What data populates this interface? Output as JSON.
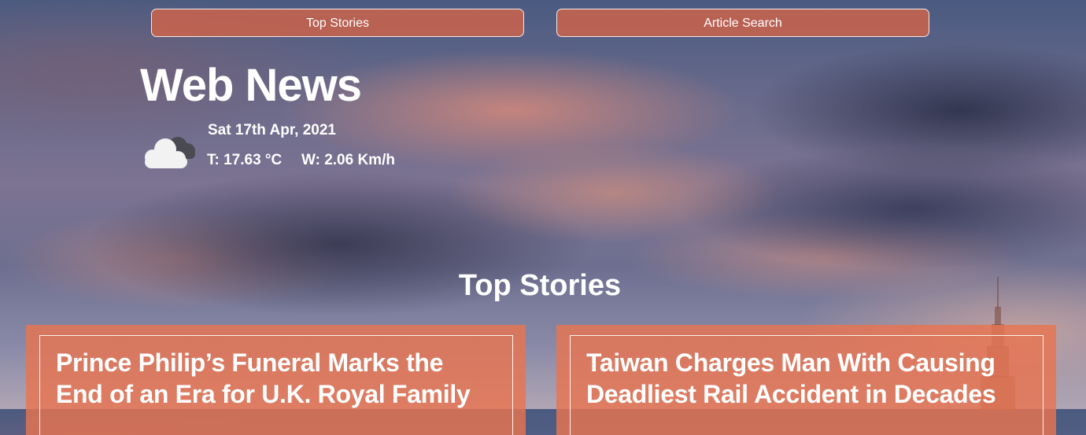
{
  "nav": {
    "top_stories_label": "Top Stories",
    "article_search_label": "Article Search"
  },
  "header": {
    "site_title": "Web News",
    "date": "Sat 17th Apr, 2021",
    "temperature": "T: 17.63 °C",
    "wind": "W: 2.06 Km/h",
    "weather_icon": "cloudy-icon"
  },
  "main": {
    "section_title": "Top Stories",
    "articles": [
      {
        "title": "Prince Philip’s Funeral Marks the End of an Era for U.K. Royal Family"
      },
      {
        "title": "Taiwan Charges Man With Causing Deadliest Rail Accident in Decades"
      }
    ]
  },
  "colors": {
    "accent": "#d6644a",
    "card_background": "#e87450",
    "text": "#ffffff"
  }
}
